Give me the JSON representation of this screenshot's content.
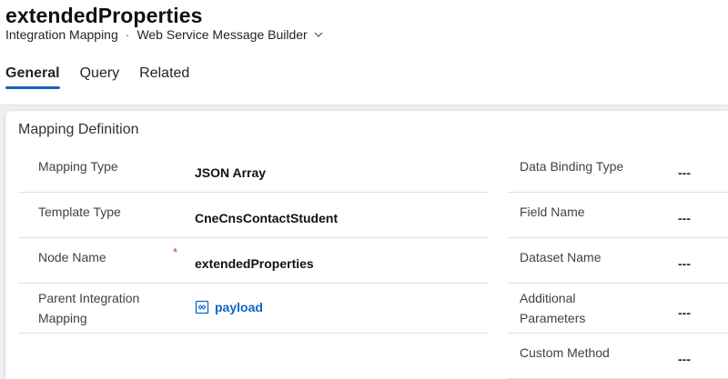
{
  "record": {
    "title": "extendedProperties",
    "entity": "Integration Mapping",
    "separator": "·",
    "form": "Web Service Message Builder"
  },
  "tabs": [
    {
      "label": "General",
      "active": true
    },
    {
      "label": "Query",
      "active": false
    },
    {
      "label": "Related",
      "active": false
    }
  ],
  "section": {
    "title": "Mapping Definition",
    "left_fields": [
      {
        "label": "Mapping Type",
        "value": "JSON Array"
      },
      {
        "label": "Template Type",
        "value": "CneCnsContactStudent"
      },
      {
        "label": "Node Name",
        "value": "extendedProperties",
        "required_marker": "*"
      },
      {
        "label": "Parent Integration Mapping",
        "value": "payload",
        "lookup_icon": "entity-record-icon"
      }
    ],
    "right_fields": [
      {
        "label": "Data Binding Type",
        "value": "---"
      },
      {
        "label": "Field Name",
        "value": "---"
      },
      {
        "label": "Dataset Name",
        "value": "---"
      },
      {
        "label": "Additional Parameters",
        "value": "---"
      },
      {
        "label": "Custom Method",
        "value": "---"
      }
    ]
  },
  "colors": {
    "accent": "#1b5fbd",
    "link": "#1164c4",
    "required": "#c4314b"
  }
}
